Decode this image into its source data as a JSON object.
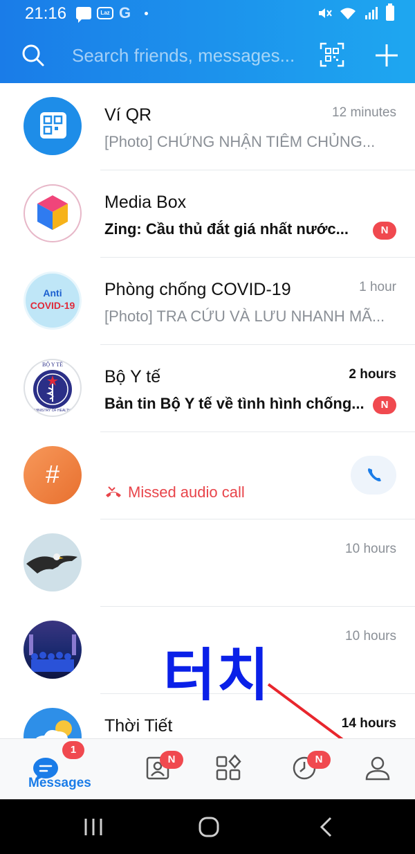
{
  "status_bar": {
    "time": "21:16",
    "laz_label": "Laz",
    "g_label": "G"
  },
  "header": {
    "search_placeholder": "Search friends, messages..."
  },
  "conversations": [
    {
      "name": "Ví QR",
      "preview": "[Photo] CHỨNG NHẬN TIÊM CHỦNG...",
      "time": "12 minutes",
      "unread": false
    },
    {
      "name": "Media Box",
      "preview": "Zing: Cầu thủ đắt giá nhất nước...",
      "time": "",
      "unread": true,
      "badge": "N"
    },
    {
      "name": "Phòng chống COVID-19",
      "preview": "[Photo] TRA CỨU VÀ LƯU NHANH MÃ...",
      "time": "1 hour",
      "unread": false,
      "avatar_text_1": "Anti",
      "avatar_text_2": "COVID-19"
    },
    {
      "name": "Bộ Y tế",
      "preview": "Bản tin Bộ Y tế về tình hình chống...",
      "time": "2 hours",
      "unread": true,
      "badge": "N",
      "avatar_text_1": "BỘ Y TẾ",
      "avatar_text_2": "MINISTRY OF HEALTH"
    },
    {
      "name": "",
      "preview": "Missed audio call",
      "time": "",
      "unread": false,
      "avatar_text_1": "#"
    },
    {
      "name": "",
      "preview": "",
      "time": "10 hours",
      "unread": false
    },
    {
      "name": "",
      "preview": "",
      "time": "10 hours",
      "unread": false
    },
    {
      "name": "Thời Tiết",
      "preview": "",
      "time": "14 hours",
      "unread": true
    }
  ],
  "overlay": {
    "touch_label": "터치"
  },
  "tabbar": {
    "messages_label": "Messages",
    "messages_badge": "1",
    "contacts_badge": "N",
    "timeline_badge": "N"
  },
  "colors": {
    "brand": "#1a7ce8",
    "badge": "#f0494f",
    "missed": "#e8444a",
    "overlay": "#0a20e8"
  }
}
